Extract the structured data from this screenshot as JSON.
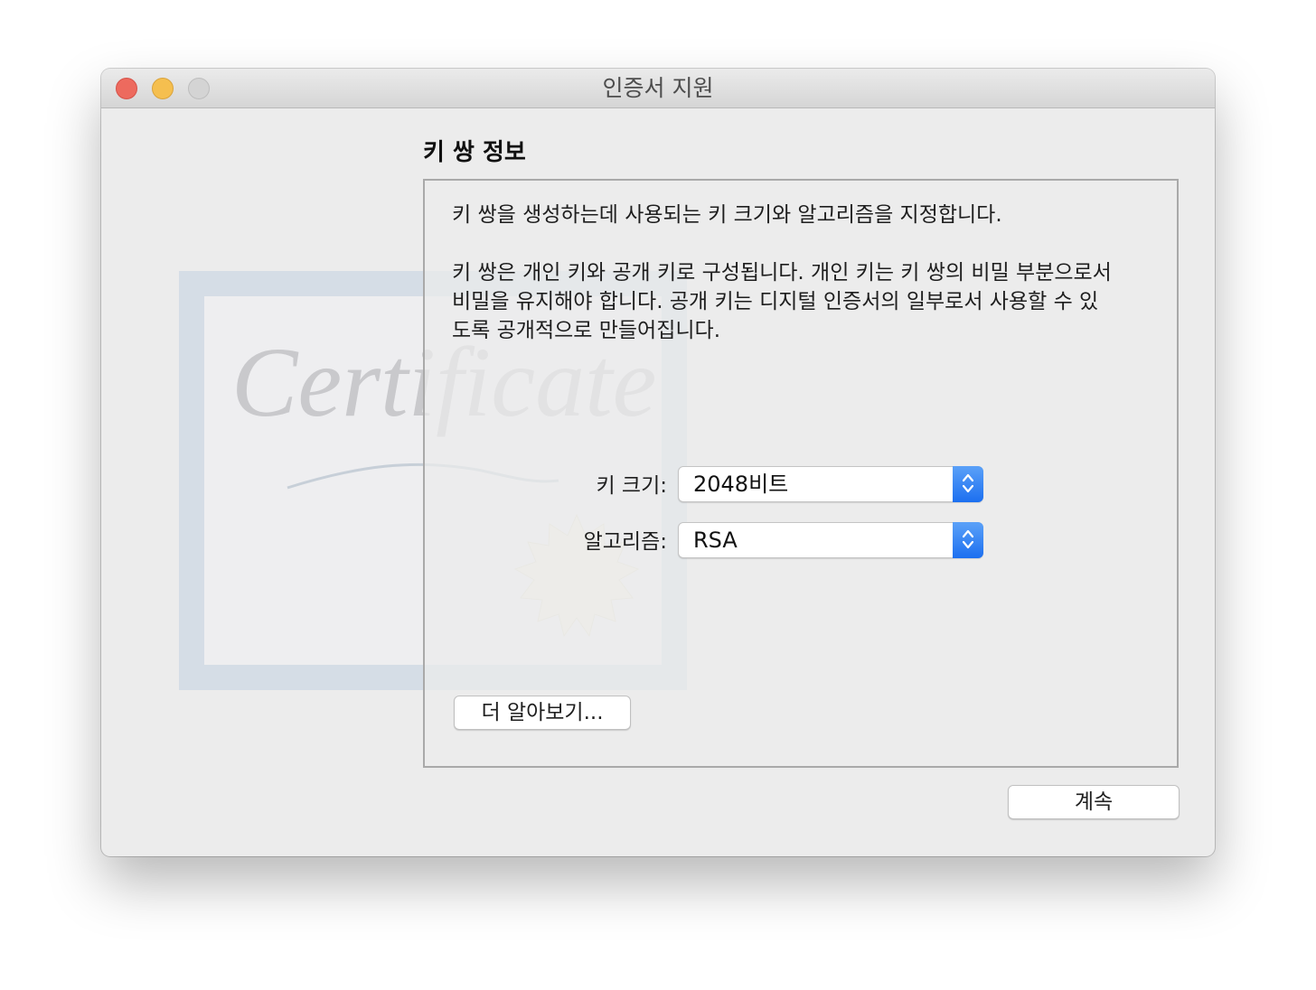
{
  "window": {
    "title": "인증서 지원",
    "traffic_lights": [
      "close",
      "minimize",
      "zoom"
    ]
  },
  "artwork": {
    "text": "Certificate"
  },
  "section": {
    "heading": "키 쌍 정보",
    "description_1": "키 쌍을 생성하는데 사용되는 키 크기와 알고리즘을 지정합니다.",
    "description_2": "키 쌍은 개인 키와 공개 키로 구성됩니다. 개인 키는 키 쌍의 비밀 부분으로서\n비밀을 유지해야 합니다. 공개 키는 디지털 인증서의 일부로서 사용할 수 있\n도록 공개적으로 만들어집니다."
  },
  "fields": {
    "key_size": {
      "label": "키 크기:",
      "value": "2048비트"
    },
    "algorithm": {
      "label": "알고리즘:",
      "value": "RSA"
    }
  },
  "buttons": {
    "learn_more": "더 알아보기...",
    "continue": "계속"
  },
  "colors": {
    "accent": "#1c6ff0",
    "close": "#ed6a5e",
    "minimize": "#f5bf4f",
    "zoom": "#d4d4d4"
  }
}
